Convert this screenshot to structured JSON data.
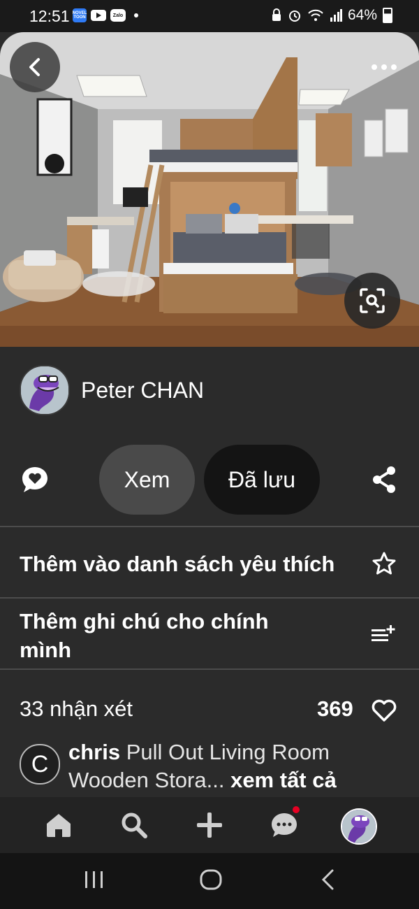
{
  "status_bar": {
    "time": "12:51",
    "battery": "64%",
    "apps": [
      "NOVEL TOON",
      "YouTube",
      "Zalo"
    ]
  },
  "pin": {
    "image_alt": "Loft bed bedroom interior",
    "icons": {
      "back": "chevron-left-icon",
      "more": "more-horizontal-icon",
      "visual_search": "lens-search-icon"
    }
  },
  "author": {
    "name": "Peter CHAN"
  },
  "actions": {
    "view_label": "Xem",
    "saved_label": "Đã lưu"
  },
  "menu": {
    "favorites_label": "Thêm vào danh sách yêu thích",
    "note_label": "Thêm ghi chú cho chính mình"
  },
  "comments": {
    "count_label": "33 nhận xét",
    "likes": "369",
    "preview": {
      "avatar_letter": "C",
      "user": "chris",
      "text": "Pull Out Living Room Wooden Stora...",
      "see_all": "xem tất cả"
    }
  },
  "colors": {
    "background": "#2b2b2b",
    "saved_button": "#141414",
    "view_button": "#4a4a4a",
    "notification": "#e60023"
  }
}
